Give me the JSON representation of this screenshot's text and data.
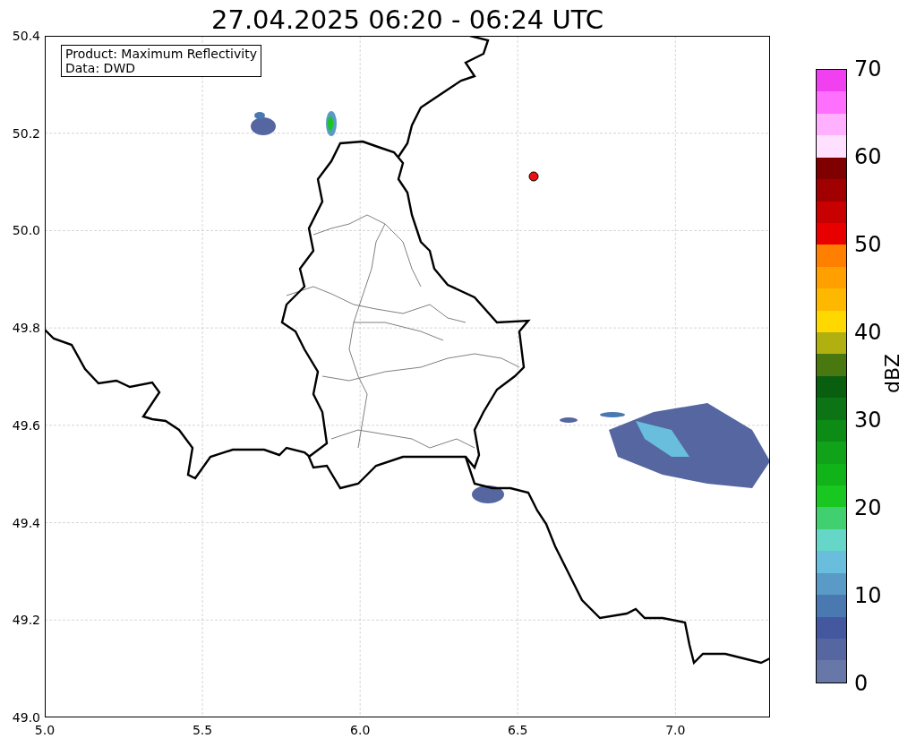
{
  "title": "27.04.2025 06:20 - 06:24 UTC",
  "info_box": [
    "Product: Maximum Reflectivity",
    "Data: DWD"
  ],
  "map": {
    "xticks": [
      "5.0",
      "5.5",
      "6.0",
      "6.5",
      "7.0"
    ],
    "yticks": [
      "50.4",
      "50.2",
      "50.0",
      "49.8",
      "49.6",
      "49.4",
      "49.2",
      "49.0"
    ]
  },
  "colorbar": {
    "label": "dBZ",
    "ticks": [
      "70",
      "60",
      "50",
      "40",
      "30",
      "20",
      "10",
      "0"
    ],
    "segments": [
      {
        "color": "#f040f0"
      },
      {
        "color": "#ff70ff"
      },
      {
        "color": "#ffb0ff"
      },
      {
        "color": "#ffe0ff"
      },
      {
        "color": "#800000"
      },
      {
        "color": "#a00000"
      },
      {
        "color": "#c80000"
      },
      {
        "color": "#e80000"
      },
      {
        "color": "#ff8000"
      },
      {
        "color": "#ffa000"
      },
      {
        "color": "#ffb800"
      },
      {
        "color": "#ffd800"
      },
      {
        "color": "#b0b010"
      },
      {
        "color": "#4a7810"
      },
      {
        "color": "#0a5e10"
      },
      {
        "color": "#0c7414"
      },
      {
        "color": "#0c8c14"
      },
      {
        "color": "#10a218"
      },
      {
        "color": "#10b418"
      },
      {
        "color": "#18c820"
      },
      {
        "color": "#40d070"
      },
      {
        "color": "#66d6c8"
      },
      {
        "color": "#68bedc"
      },
      {
        "color": "#5a9ac6"
      },
      {
        "color": "#4a78b0"
      },
      {
        "color": "#4458a0"
      },
      {
        "color": "#5566a0"
      },
      {
        "color": "#6677a8"
      }
    ]
  }
}
